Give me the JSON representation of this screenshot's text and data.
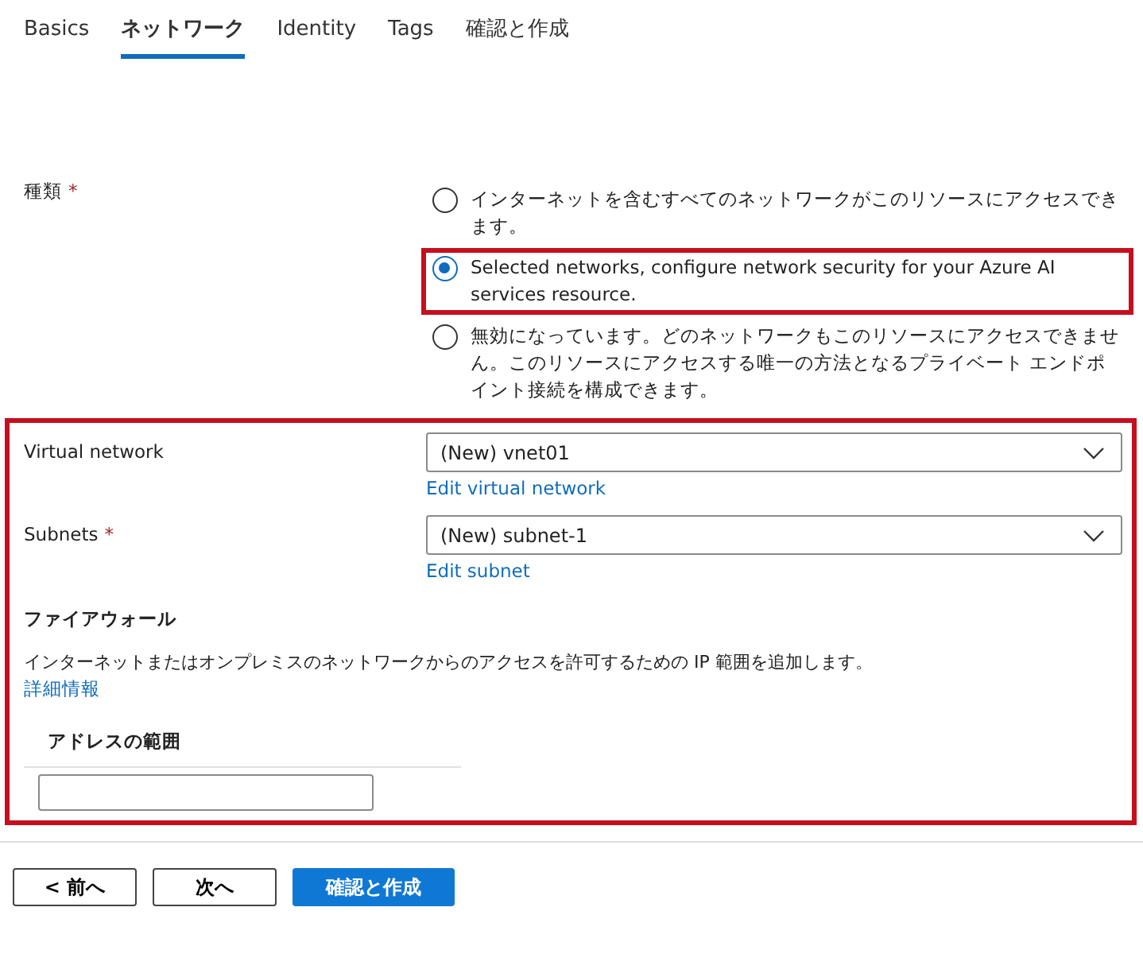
{
  "tabs": [
    {
      "label": "Basics",
      "selected": false
    },
    {
      "label": "ネットワーク",
      "selected": true
    },
    {
      "label": "Identity",
      "selected": false
    },
    {
      "label": "Tags",
      "selected": false
    },
    {
      "label": "確認と作成",
      "selected": false
    }
  ],
  "connectivity": {
    "label": "種類",
    "required_mark": "*",
    "options": [
      {
        "label": "インターネットを含むすべてのネットワークがこのリソースにアクセスできます。",
        "selected": false,
        "highlighted": false
      },
      {
        "label": "Selected networks, configure network security for your Azure AI services resource.",
        "selected": true,
        "highlighted": true
      },
      {
        "label": "無効になっています。どのネットワークもこのリソースにアクセスできません。このリソースにアクセスする唯一の方法となるプライベート エンドポイント接続を構成できます。",
        "selected": false,
        "highlighted": false
      }
    ]
  },
  "network_section": {
    "highlighted": true,
    "fields": [
      {
        "label": "Virtual network",
        "value": "(New) vnet01",
        "link": "Edit virtual network"
      },
      {
        "label": "Subnets",
        "required_mark": "*",
        "value": "(New) subnet-1",
        "link": "Edit subnet"
      }
    ],
    "firewall": {
      "heading": "ファイアウォール",
      "description": "インターネットまたはオンプレミスのネットワークからのアクセスを許可するための IP 範囲を追加します。",
      "link": "詳細情報",
      "column": "アドレスの範囲"
    }
  },
  "buttons": [
    {
      "label": "< 前へ",
      "kind": "secondary"
    },
    {
      "label": "次へ",
      "kind": "secondary"
    },
    {
      "label": "確認と作成",
      "kind": "primary"
    }
  ]
}
